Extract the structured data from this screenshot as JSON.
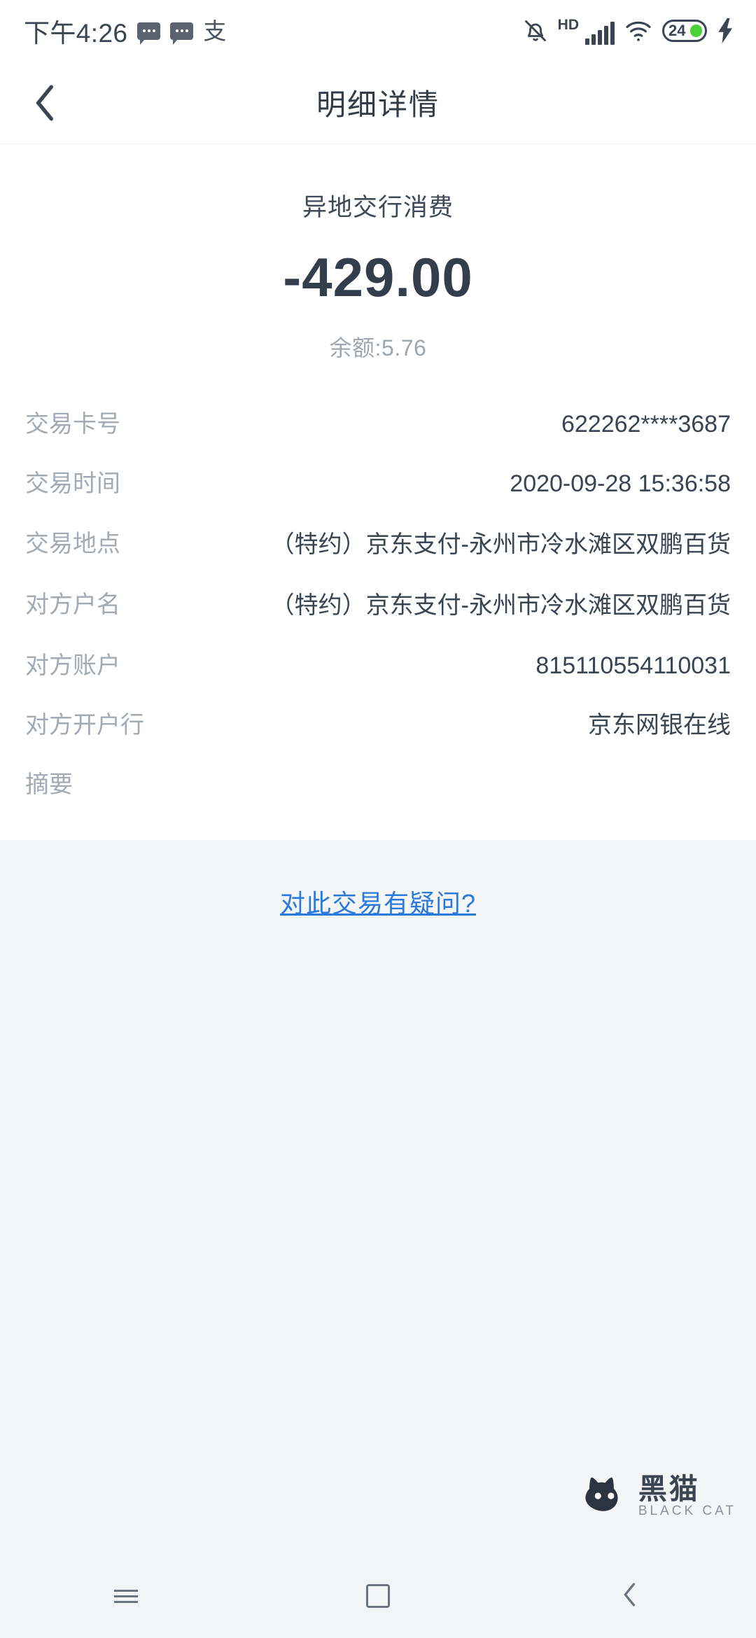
{
  "status_bar": {
    "time": "下午4:26",
    "hd_label": "HD",
    "battery_level": "24",
    "icons": [
      "message-bubble-icon",
      "message-bubble-icon",
      "alipay-icon",
      "mute-bell-icon",
      "signal-bars-icon",
      "wifi-icon",
      "battery-icon",
      "charging-bolt-icon"
    ],
    "alipay_glyph": "支"
  },
  "app_bar": {
    "title": "明细详情",
    "back_icon": "chevron-left-icon"
  },
  "summary": {
    "transaction_type": "异地交行消费",
    "amount": "-429.00",
    "balance": "余额:5.76"
  },
  "details": [
    {
      "label": "交易卡号",
      "value": "622262****3687"
    },
    {
      "label": "交易时间",
      "value": "2020-09-28 15:36:58"
    },
    {
      "label": "交易地点",
      "value": "（特约）京东支付-永州市冷水滩区双鹏百货"
    },
    {
      "label": "对方户名",
      "value": "（特约）京东支付-永州市冷水滩区双鹏百货"
    },
    {
      "label": "对方账户",
      "value": "815110554110031"
    },
    {
      "label": "对方开户行",
      "value": "京东网银在线"
    },
    {
      "label": "摘要",
      "value": ""
    }
  ],
  "footer": {
    "question_link": "对此交易有疑问?",
    "link_color": "#2a7ade"
  },
  "watermark": {
    "name_cn": "黑猫",
    "name_en": "BLACK CAT",
    "logo_icon": "cat-head-icon"
  },
  "nav_bar": {
    "items": [
      "menu-button",
      "home-button",
      "back-button"
    ]
  }
}
